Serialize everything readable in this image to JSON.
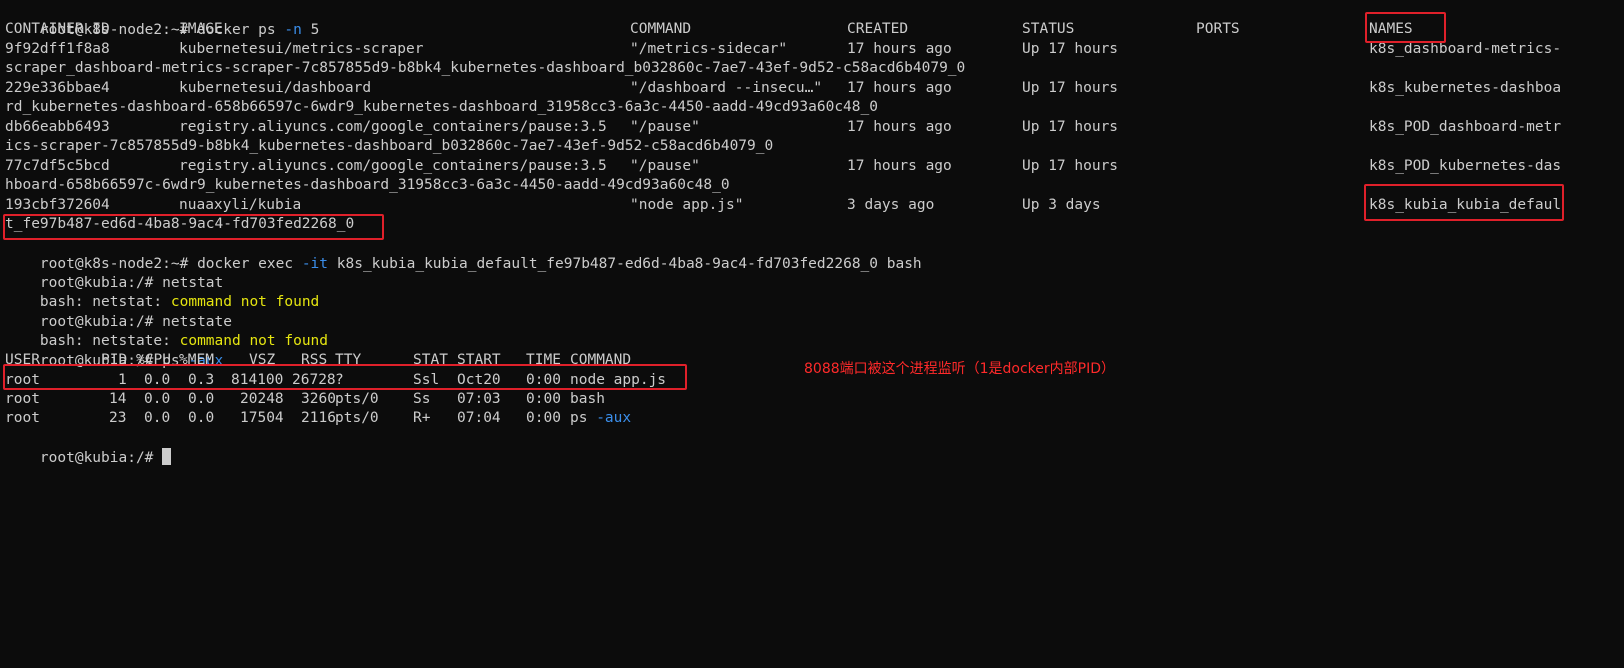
{
  "terminal": {
    "prompt_host": "root@k8s-node2:~#",
    "cmd1": "docker ps",
    "cmd1_flag": "-n",
    "cmd1_arg": "5",
    "headers": {
      "container_id": "CONTAINER ID",
      "image": "IMAGE",
      "command": "COMMAND",
      "created": "CREATED",
      "status": "STATUS",
      "ports": "PORTS",
      "names": "NAMES"
    },
    "containers": [
      {
        "id": "9f92dff1f8a8",
        "image": "kubernetesui/metrics-scraper",
        "command": "\"/metrics-sidecar\"",
        "created": "17 hours ago",
        "status": "Up 17 hours",
        "ports": "",
        "name": "k8s_dashboard-metrics-",
        "name_cont": "scraper_dashboard-metrics-scraper-7c857855d9-b8bk4_kubernetes-dashboard_b032860c-7ae7-43ef-9d52-c58acd6b4079_0"
      },
      {
        "id": "229e336bbae4",
        "image": "kubernetesui/dashboard",
        "command": "\"/dashboard --insecu…\"",
        "created": "17 hours ago",
        "status": "Up 17 hours",
        "ports": "",
        "name": "k8s_kubernetes-dashboa",
        "name_cont": "rd_kubernetes-dashboard-658b66597c-6wdr9_kubernetes-dashboard_31958cc3-6a3c-4450-aadd-49cd93a60c48_0"
      },
      {
        "id": "db66eabb6493",
        "image": "registry.aliyuncs.com/google_containers/pause:3.5",
        "command": "\"/pause\"",
        "created": "17 hours ago",
        "status": "Up 17 hours",
        "ports": "",
        "name": "k8s_POD_dashboard-metr",
        "name_cont": "ics-scraper-7c857855d9-b8bk4_kubernetes-dashboard_b032860c-7ae7-43ef-9d52-c58acd6b4079_0"
      },
      {
        "id": "77c7df5c5bcd",
        "image": "registry.aliyuncs.com/google_containers/pause:3.5",
        "command": "\"/pause\"",
        "created": "17 hours ago",
        "status": "Up 17 hours",
        "ports": "",
        "name": "k8s_POD_kubernetes-das",
        "name_cont": "hboard-658b66597c-6wdr9_kubernetes-dashboard_31958cc3-6a3c-4450-aadd-49cd93a60c48_0"
      },
      {
        "id": "193cbf372604",
        "image": "nuaaxyli/kubia",
        "command": "\"node app.js\"",
        "created": "3 days ago",
        "status": "Up 3 days",
        "ports": "",
        "name": "k8s_kubia_kubia_defaul",
        "name_cont": "t_fe97b487-ed6d-4ba8-9ac4-fd703fed2268_0"
      }
    ],
    "cmd2": "docker exec",
    "cmd2_flag": "-it",
    "cmd2_arg": "k8s_kubia_kubia_default_fe97b487-ed6d-4ba8-9ac4-fd703fed2268_0 bash",
    "prompt_kubia": "root@kubia:/#",
    "cmd3": "netstat",
    "err1_prefix": "bash: netstat:",
    "err_msg": "command not found",
    "cmd4": "netstate",
    "err2_prefix": "bash: netstate:",
    "cmd5": "ps",
    "cmd5_flag": "-aux",
    "ps_headers": {
      "user": "USER",
      "pid": "PID",
      "cpu": "%CPU",
      "mem": "%MEM",
      "vsz": "VSZ",
      "rss": "RSS",
      "tty": "TTY",
      "stat": "STAT",
      "start": "START",
      "time": "TIME",
      "command": "COMMAND"
    },
    "processes": [
      {
        "user": "root",
        "pid": "1",
        "cpu": "0.0",
        "mem": "0.3",
        "vsz": "814100",
        "rss": "26728",
        "tty": "?",
        "stat": "Ssl",
        "start": "Oct20",
        "time": "0:00",
        "command": "node app.js",
        "command_flag": ""
      },
      {
        "user": "root",
        "pid": "14",
        "cpu": "0.0",
        "mem": "0.0",
        "vsz": "20248",
        "rss": "3260",
        "tty": "pts/0",
        "stat": "Ss",
        "start": "07:03",
        "time": "0:00",
        "command": "bash",
        "command_flag": ""
      },
      {
        "user": "root",
        "pid": "23",
        "cpu": "0.0",
        "mem": "0.0",
        "vsz": "17504",
        "rss": "2116",
        "tty": "pts/0",
        "stat": "R+",
        "start": "07:04",
        "time": "0:00",
        "command": "ps",
        "command_flag": "-aux"
      }
    ],
    "annotation": "8088端口被这个进程监听（1是docker内部PID）",
    "colors": {
      "background": "#0c0c0c",
      "text": "#cccccc",
      "flag": "#3b8eea",
      "error": "#e5e510",
      "highlight_box": "#e0202a",
      "annotation": "#ff2a2a"
    }
  }
}
